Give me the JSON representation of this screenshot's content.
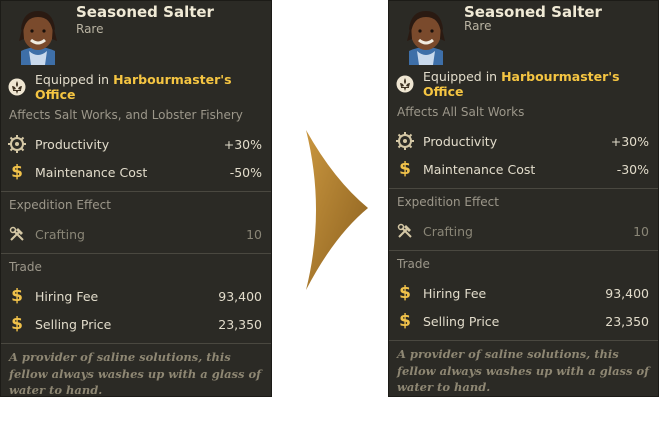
{
  "before": {
    "name": "Seasoned Salter",
    "rarity": "Rare",
    "equipped_prefix": "Equipped in",
    "equipped_place": "Harbourmaster's Office",
    "affects": "Affects Salt Works, and Lobster Fishery",
    "stats": [
      {
        "label": "Productivity",
        "value": "+30%",
        "icon": "gear-icon"
      },
      {
        "label": "Maintenance Cost",
        "value": "-50%",
        "icon": "coin-dollar-icon"
      }
    ],
    "expedition_title": "Expedition Effect",
    "expedition": {
      "label": "Crafting",
      "value": "10",
      "icon": "hammer-wrench-icon"
    },
    "trade_title": "Trade",
    "trade": [
      {
        "label": "Hiring Fee",
        "value": "93,400",
        "icon": "coin-dollar-icon"
      },
      {
        "label": "Selling Price",
        "value": "23,350",
        "icon": "coin-dollar-icon"
      }
    ],
    "flavor": "A provider of saline solutions, this fellow always washes up with a glass of water to hand."
  },
  "after": {
    "name": "Seasoned Salter",
    "rarity": "Rare",
    "equipped_prefix": "Equipped in",
    "equipped_place": "Harbourmaster's Office",
    "affects": "Affects All Salt Works",
    "stats": [
      {
        "label": "Productivity",
        "value": "+30%",
        "icon": "gear-icon"
      },
      {
        "label": "Maintenance Cost",
        "value": "-30%",
        "icon": "coin-dollar-icon"
      }
    ],
    "expedition_title": "Expedition Effect",
    "expedition": {
      "label": "Crafting",
      "value": "10",
      "icon": "hammer-wrench-icon"
    },
    "trade_title": "Trade",
    "trade": [
      {
        "label": "Hiring Fee",
        "value": "93,400",
        "icon": "coin-dollar-icon"
      },
      {
        "label": "Selling Price",
        "value": "23,350",
        "icon": "coin-dollar-icon"
      }
    ],
    "flavor": "A provider of saline solutions, this fellow always washes up with a glass of water to hand."
  },
  "colors": {
    "card_bg": "#2b2a25",
    "highlight": "#f5c542",
    "arrow": "#a97a2c"
  }
}
